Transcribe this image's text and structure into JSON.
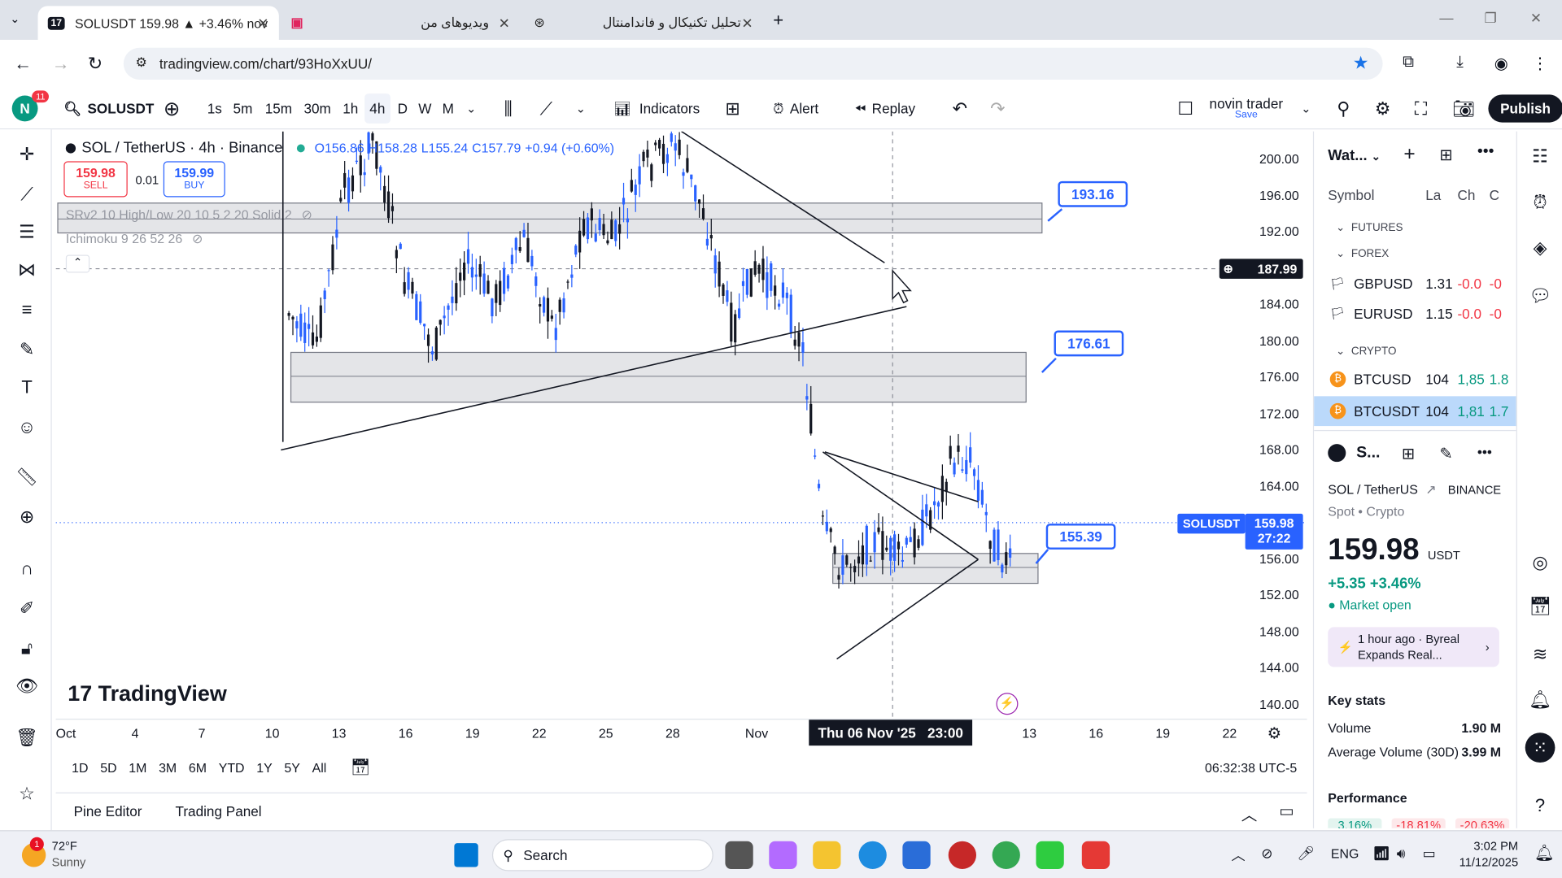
{
  "browser": {
    "tabs": [
      {
        "title": "SOLUSDT 159.98 ▲ +3.46% nov"
      },
      {
        "title": "ویدیوهای من"
      },
      {
        "title": "تحلیل تکنیکال و فاندامنتال"
      }
    ],
    "url": "tradingview.com/chart/93HoXxUU/"
  },
  "toolbar": {
    "avatar_letter": "N",
    "notif_count": "11",
    "symbol": "SOLUSDT",
    "intervals": [
      "1s",
      "5m",
      "15m",
      "30m",
      "1h",
      "4h",
      "D",
      "W",
      "M"
    ],
    "active_interval": "4h",
    "indicators_label": "Indicators",
    "alert_label": "Alert",
    "replay_label": "Replay",
    "layout_name": "novin trader",
    "layout_save": "Save",
    "publish_label": "Publish"
  },
  "legend": {
    "title": "SOL / TetherUS · 4h · Binance",
    "o": "O156.86",
    "h": "H158.28",
    "l": "L155.24",
    "c": "C157.79",
    "chg": "+0.94 (+0.60%)",
    "sell_price": "159.98",
    "sell_label": "SELL",
    "spread": "0.01",
    "buy_price": "159.99",
    "buy_label": "BUY",
    "ind1": "SRv2 10 High/Low 20 10 5 2 20 Solid 2",
    "ind2": "Ichimoku 9 26 52 26"
  },
  "zones": {
    "z1": "193.16",
    "z2": "176.61",
    "z3": "155.39"
  },
  "price_axis": {
    "ticks": [
      "200.00",
      "196.00",
      "192.00",
      "188.00",
      "184.00",
      "180.00",
      "176.00",
      "172.00",
      "168.00",
      "164.00",
      "160.00",
      "156.00",
      "152.00",
      "148.00",
      "144.00",
      "140.00"
    ],
    "crosshair": "187.99",
    "last_symbol": "SOLUSDT",
    "last_price": "159.98",
    "countdown": "27:22"
  },
  "time_axis": {
    "ticks": [
      "Oct",
      "4",
      "7",
      "10",
      "13",
      "16",
      "19",
      "22",
      "25",
      "28",
      "Nov",
      "13",
      "16",
      "19",
      "22"
    ],
    "crosshair": "Thu 06 Nov '25   23:00"
  },
  "ranges": [
    "1D",
    "5D",
    "1M",
    "3M",
    "6M",
    "YTD",
    "1Y",
    "5Y",
    "All"
  ],
  "clock": "06:32:38 UTC-5",
  "bottom_tabs": [
    "Pine Editor",
    "Trading Panel"
  ],
  "watermark": "TradingView",
  "watchlist": {
    "title": "Wat...",
    "cols": [
      "Symbol",
      "La",
      "Ch",
      "C"
    ],
    "groups": [
      {
        "name": "FUTURES",
        "rows": []
      },
      {
        "name": "FOREX",
        "rows": [
          {
            "sym": "GBPUSD",
            "last": "1.31",
            "ch": "-0.0",
            "chp": "-0"
          },
          {
            "sym": "EURUSD",
            "last": "1.15",
            "ch": "-0.0",
            "chp": "-0"
          }
        ]
      },
      {
        "name": "CRYPTO",
        "rows": [
          {
            "sym": "BTCUSD",
            "last": "104",
            "ch": "1,85",
            "chp": "1.8"
          },
          {
            "sym": "BTCUSDT",
            "last": "104",
            "ch": "1,81",
            "chp": "1.7"
          }
        ]
      }
    ]
  },
  "details": {
    "short": "S...",
    "name": "SOL / TetherUS",
    "exchange": "BINANCE",
    "type": "Spot • Crypto",
    "price": "159.98",
    "currency": "USDT",
    "change": "+5.35 +3.46%",
    "status": "Market open",
    "news_time": "1 hour ago · Byreal",
    "news_title": "Expands Real...",
    "key_stats": "Key stats",
    "volume_label": "Volume",
    "volume": "1.90 M",
    "avgvol_label": "Average Volume (30D)",
    "avgvol": "3.99 M",
    "performance": "Performance",
    "perf": [
      "3.16%",
      "-18.81%",
      "-20.63%"
    ]
  },
  "taskbar": {
    "weather_temp": "72°F",
    "weather_desc": "Sunny",
    "search": "Search",
    "lang": "ENG",
    "time": "3:02 PM",
    "date": "11/12/2025"
  },
  "colors": {
    "accent": "#2962ff",
    "up": "#2962ff",
    "down": "#131722",
    "green": "#089981",
    "red": "#f23645"
  }
}
